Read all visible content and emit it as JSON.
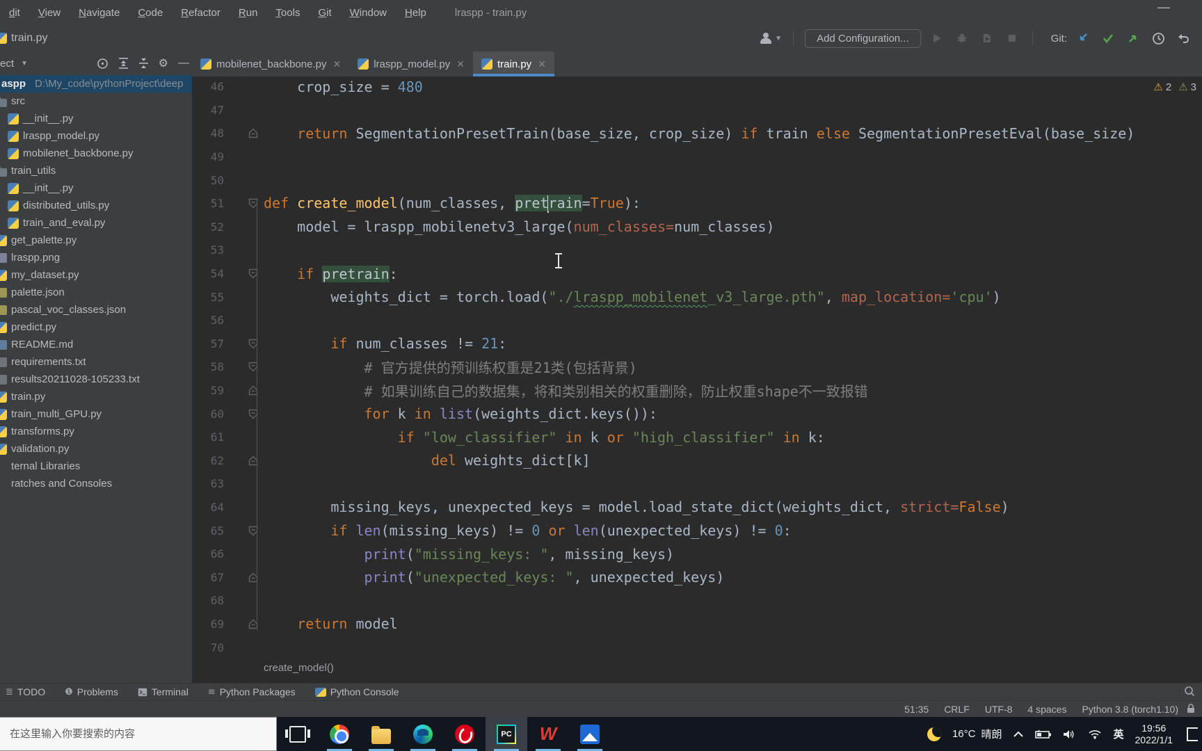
{
  "window": {
    "menus": [
      "dit",
      "View",
      "Navigate",
      "Code",
      "Refactor",
      "Run",
      "Tools",
      "Git",
      "Window",
      "Help"
    ],
    "title": "lraspp - train.py",
    "minimize_glyph": "—"
  },
  "navbar": {
    "file": "train.py",
    "add_config_label": "Add Configuration...",
    "git_label": "Git:",
    "run_controls": [
      "run-icon",
      "debug-icon",
      "coverage-icon",
      "stop-icon"
    ],
    "git_actions": [
      "update-project-icon",
      "commit-icon",
      "push-icon",
      "history-icon",
      "rollback-icon"
    ]
  },
  "project": {
    "header_label": "ect",
    "root": {
      "name": "aspp",
      "path": "D:\\My_code\\pythonProject\\deep"
    },
    "items": [
      {
        "label": "src",
        "icon": "folder",
        "indent": 0
      },
      {
        "label": "__init__.py",
        "icon": "python",
        "indent": 1
      },
      {
        "label": "lraspp_model.py",
        "icon": "python",
        "indent": 1
      },
      {
        "label": "mobilenet_backbone.py",
        "icon": "python",
        "indent": 1
      },
      {
        "label": "train_utils",
        "icon": "folder",
        "indent": 0
      },
      {
        "label": "__init__.py",
        "icon": "python",
        "indent": 1
      },
      {
        "label": "distributed_utils.py",
        "icon": "python",
        "indent": 1
      },
      {
        "label": "train_and_eval.py",
        "icon": "python",
        "indent": 1
      },
      {
        "label": "get_palette.py",
        "icon": "python",
        "indent": 0
      },
      {
        "label": "lraspp.png",
        "icon": "image",
        "indent": 0
      },
      {
        "label": "my_dataset.py",
        "icon": "python",
        "indent": 0
      },
      {
        "label": "palette.json",
        "icon": "json",
        "indent": 0
      },
      {
        "label": "pascal_voc_classes.json",
        "icon": "json",
        "indent": 0
      },
      {
        "label": "predict.py",
        "icon": "python",
        "indent": 0
      },
      {
        "label": "README.md",
        "icon": "md",
        "indent": 0
      },
      {
        "label": "requirements.txt",
        "icon": "file",
        "indent": 0
      },
      {
        "label": "results20211028-105233.txt",
        "icon": "file",
        "indent": 0
      },
      {
        "label": "train.py",
        "icon": "python",
        "indent": 0
      },
      {
        "label": "train_multi_GPU.py",
        "icon": "python",
        "indent": 0
      },
      {
        "label": "transforms.py",
        "icon": "python",
        "indent": 0
      },
      {
        "label": "validation.py",
        "icon": "python",
        "indent": 0
      },
      {
        "label": "ternal Libraries",
        "icon": "none",
        "indent": 0
      },
      {
        "label": "ratches and Consoles",
        "icon": "none",
        "indent": 0
      }
    ]
  },
  "tabs": [
    {
      "label": "mobilenet_backbone.py",
      "active": false
    },
    {
      "label": "lraspp_model.py",
      "active": false
    },
    {
      "label": "train.py",
      "active": true
    }
  ],
  "editor": {
    "inspections": [
      {
        "count": "2",
        "color": "#e8a33d"
      },
      {
        "count": "3",
        "color": "#98955c"
      }
    ],
    "breadcrumb": "create_model()",
    "lines": [
      {
        "num": "46",
        "gutter": null,
        "tokens": [
          [
            "d",
            "    crop_size = "
          ],
          [
            "num",
            "480"
          ]
        ]
      },
      {
        "num": "47",
        "gutter": null,
        "tokens": []
      },
      {
        "num": "48",
        "gutter": "up",
        "tokens": [
          [
            "d",
            "    "
          ],
          [
            "kw",
            "return"
          ],
          [
            "d",
            " SegmentationPresetTrain(base_size, crop_size) "
          ],
          [
            "kw",
            "if"
          ],
          [
            "d",
            " train "
          ],
          [
            "kw",
            "else"
          ],
          [
            "d",
            " SegmentationPresetEval(base_size)"
          ]
        ]
      },
      {
        "num": "49",
        "gutter": null,
        "tokens": []
      },
      {
        "num": "50",
        "gutter": null,
        "tokens": []
      },
      {
        "num": "51",
        "gutter": "down",
        "tokens": [
          [
            "kw",
            "def"
          ],
          [
            "d",
            " "
          ],
          [
            "fn",
            "create_model"
          ],
          [
            "d",
            "(num_classes, "
          ],
          [
            "hl",
            "pret"
          ],
          [
            "caret",
            ""
          ],
          [
            "hl",
            "rain"
          ],
          [
            "d",
            "="
          ],
          [
            "kw",
            "True"
          ],
          [
            "d",
            "):"
          ]
        ]
      },
      {
        "num": "52",
        "gutter": null,
        "tokens": [
          [
            "d",
            "    model = lraspp_mobilenetv3_large("
          ],
          [
            "ka",
            "num_classes="
          ],
          [
            "d",
            "num_classes)"
          ]
        ]
      },
      {
        "num": "53",
        "gutter": null,
        "tokens": []
      },
      {
        "num": "54",
        "gutter": "down",
        "tokens": [
          [
            "d",
            "    "
          ],
          [
            "kw",
            "if"
          ],
          [
            "d",
            " "
          ],
          [
            "hl",
            "pretrain"
          ],
          [
            "d",
            ":"
          ]
        ]
      },
      {
        "num": "55",
        "gutter": null,
        "tokens": [
          [
            "d",
            "        weights_dict = torch.load("
          ],
          [
            "str",
            "\"./"
          ],
          [
            "sq",
            "lraspp_mobilenet"
          ],
          [
            "str",
            "_v3_large.pth\""
          ],
          [
            "d",
            ", "
          ],
          [
            "ka",
            "map_location="
          ],
          [
            "str",
            "'cpu'"
          ],
          [
            "d",
            ")"
          ]
        ]
      },
      {
        "num": "56",
        "gutter": null,
        "tokens": []
      },
      {
        "num": "57",
        "gutter": "down",
        "tokens": [
          [
            "d",
            "        "
          ],
          [
            "kw",
            "if"
          ],
          [
            "d",
            " num_classes != "
          ],
          [
            "num",
            "21"
          ],
          [
            "d",
            ":"
          ]
        ]
      },
      {
        "num": "58",
        "gutter": "down",
        "tokens": [
          [
            "com",
            "            # 官方提供的预训练权重是21类(包括背景)"
          ]
        ]
      },
      {
        "num": "59",
        "gutter": "up",
        "tokens": [
          [
            "com",
            "            # 如果训练自己的数据集，将和类别相关的权重删除，防止权重shape不一致报错"
          ]
        ]
      },
      {
        "num": "60",
        "gutter": "down",
        "tokens": [
          [
            "d",
            "            "
          ],
          [
            "kw",
            "for"
          ],
          [
            "d",
            " k "
          ],
          [
            "kw",
            "in"
          ],
          [
            "d",
            " "
          ],
          [
            "bi",
            "list"
          ],
          [
            "d",
            "(weights_dict.keys()):"
          ]
        ]
      },
      {
        "num": "61",
        "gutter": null,
        "tokens": [
          [
            "d",
            "                "
          ],
          [
            "kw",
            "if"
          ],
          [
            "d",
            " "
          ],
          [
            "str",
            "\"low_classifier\""
          ],
          [
            "d",
            " "
          ],
          [
            "kw",
            "in"
          ],
          [
            "d",
            " k "
          ],
          [
            "kw",
            "or"
          ],
          [
            "d",
            " "
          ],
          [
            "str",
            "\"high_classifier\""
          ],
          [
            "d",
            " "
          ],
          [
            "kw",
            "in"
          ],
          [
            "d",
            " k:"
          ]
        ]
      },
      {
        "num": "62",
        "gutter": "up",
        "tokens": [
          [
            "d",
            "                    "
          ],
          [
            "kw",
            "del"
          ],
          [
            "d",
            " weights_dict[k]"
          ]
        ]
      },
      {
        "num": "63",
        "gutter": null,
        "tokens": []
      },
      {
        "num": "64",
        "gutter": null,
        "tokens": [
          [
            "d",
            "        missing_keys, unexpected_keys = model.load_state_dict(weights_dict, "
          ],
          [
            "ka",
            "strict="
          ],
          [
            "kw",
            "False"
          ],
          [
            "d",
            ")"
          ]
        ]
      },
      {
        "num": "65",
        "gutter": "down",
        "tokens": [
          [
            "d",
            "        "
          ],
          [
            "kw",
            "if"
          ],
          [
            "d",
            " "
          ],
          [
            "bi",
            "len"
          ],
          [
            "d",
            "(missing_keys) != "
          ],
          [
            "num",
            "0"
          ],
          [
            "d",
            " "
          ],
          [
            "kw",
            "or"
          ],
          [
            "d",
            " "
          ],
          [
            "bi",
            "len"
          ],
          [
            "d",
            "(unexpected_keys) != "
          ],
          [
            "num",
            "0"
          ],
          [
            "d",
            ":"
          ]
        ]
      },
      {
        "num": "66",
        "gutter": null,
        "tokens": [
          [
            "d",
            "            "
          ],
          [
            "bi",
            "print"
          ],
          [
            "d",
            "("
          ],
          [
            "str",
            "\"missing_keys: \""
          ],
          [
            "d",
            ", missing_keys)"
          ]
        ]
      },
      {
        "num": "67",
        "gutter": "up",
        "tokens": [
          [
            "d",
            "            "
          ],
          [
            "bi",
            "print"
          ],
          [
            "d",
            "("
          ],
          [
            "str",
            "\"unexpected_keys: \""
          ],
          [
            "d",
            ", unexpected_keys)"
          ]
        ]
      },
      {
        "num": "68",
        "gutter": null,
        "tokens": []
      },
      {
        "num": "69",
        "gutter": "up",
        "tokens": [
          [
            "d",
            "    "
          ],
          [
            "kw",
            "return"
          ],
          [
            "d",
            " model"
          ]
        ]
      },
      {
        "num": "70",
        "gutter": null,
        "tokens": []
      }
    ]
  },
  "toolwindows": [
    {
      "label": "TODO",
      "icon": "todo-list-icon",
      "glyph": "≣"
    },
    {
      "label": "Problems",
      "icon": "problems-icon",
      "glyph": "❶"
    },
    {
      "label": "Terminal",
      "icon": "terminal-icon",
      "glyph": "⌨"
    },
    {
      "label": "Python Packages",
      "icon": "packages-icon",
      "glyph": "≋"
    },
    {
      "label": "Python Console",
      "icon": "python-console-icon",
      "glyph": ""
    }
  ],
  "statusbar": {
    "items": [
      "51:35",
      "CRLF",
      "UTF-8",
      "4 spaces",
      "Python 3.8 (torch1.10)"
    ]
  },
  "taskbar": {
    "search_placeholder": "在这里输入你要搜索的内容",
    "apps": [
      {
        "name": "task-view",
        "running": false,
        "active": false
      },
      {
        "name": "chrome",
        "running": true,
        "active": false
      },
      {
        "name": "explorer",
        "running": true,
        "active": false
      },
      {
        "name": "edge",
        "running": true,
        "active": false
      },
      {
        "name": "netease-music",
        "running": true,
        "active": false
      },
      {
        "name": "pycharm",
        "running": true,
        "active": true,
        "label": "PC"
      },
      {
        "name": "wps",
        "running": true,
        "active": false,
        "label": "W"
      },
      {
        "name": "photos",
        "running": true,
        "active": false
      }
    ],
    "tray": {
      "weather_temp": "16°C",
      "weather_desc": "晴朗",
      "lang": "英",
      "time": "19:56",
      "date": "2022/1/1"
    }
  }
}
